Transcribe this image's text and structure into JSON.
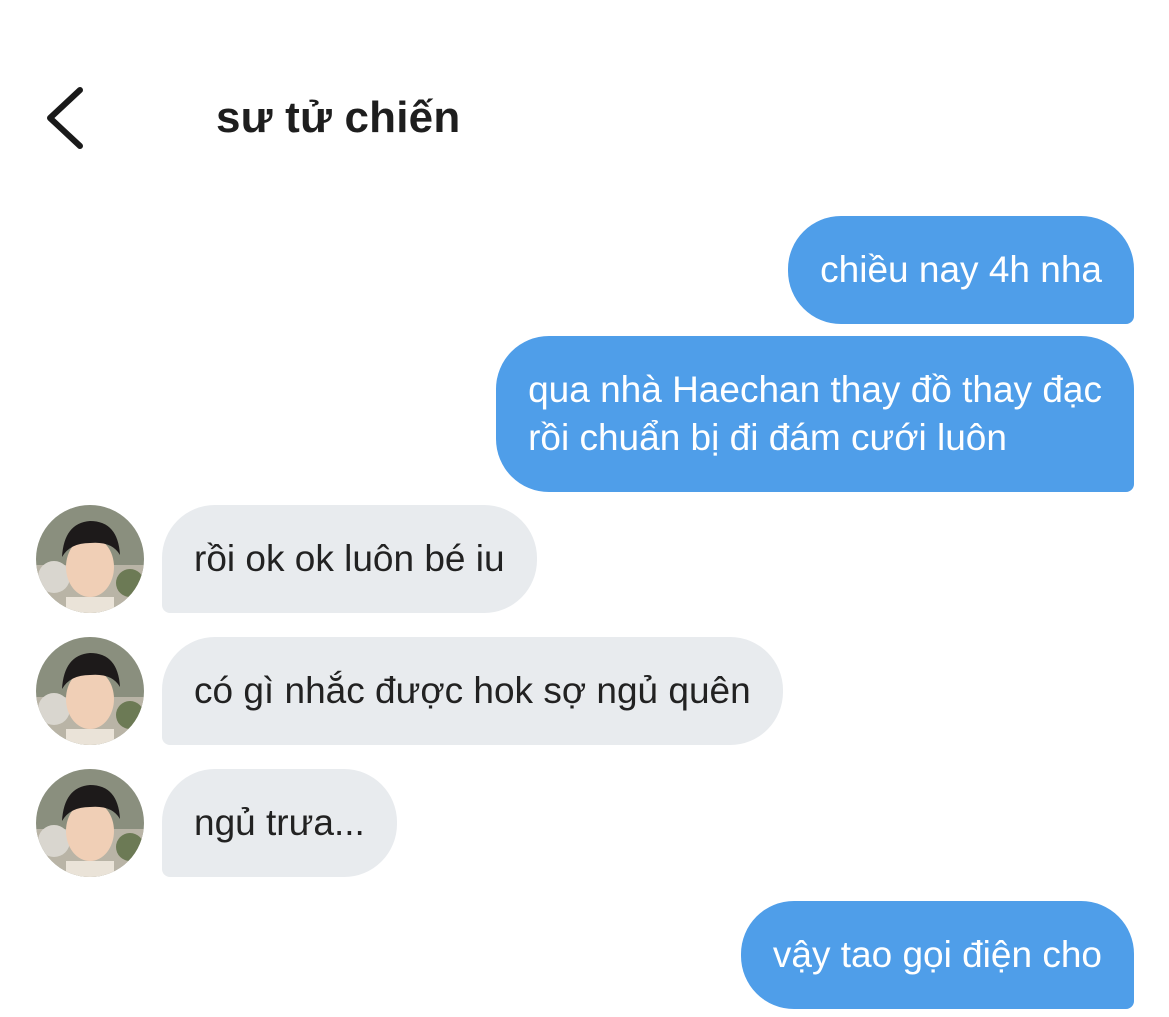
{
  "header": {
    "back_icon": "chevron-left-icon",
    "title": "sư tử chiến"
  },
  "colors": {
    "outgoing_bubble": "#4f9ee9",
    "incoming_bubble": "#e8ebee",
    "background": "#ffffff"
  },
  "messages": [
    {
      "direction": "outgoing",
      "text": "chiều nay 4h nha"
    },
    {
      "direction": "outgoing",
      "line1": "qua nhà Haechan thay đồ thay đạc",
      "line2": "rồi chuẩn bị đi đám cưới luôn"
    },
    {
      "direction": "incoming",
      "text": "rồi ok ok luôn bé iu",
      "avatar": "avatar-photo"
    },
    {
      "direction": "incoming",
      "text": "có gì nhắc được hok sợ ngủ quên",
      "avatar": "avatar-photo"
    },
    {
      "direction": "incoming",
      "text": "ngủ trưa...",
      "avatar": "avatar-photo"
    },
    {
      "direction": "outgoing",
      "text": "vậy tao gọi điện cho"
    }
  ]
}
